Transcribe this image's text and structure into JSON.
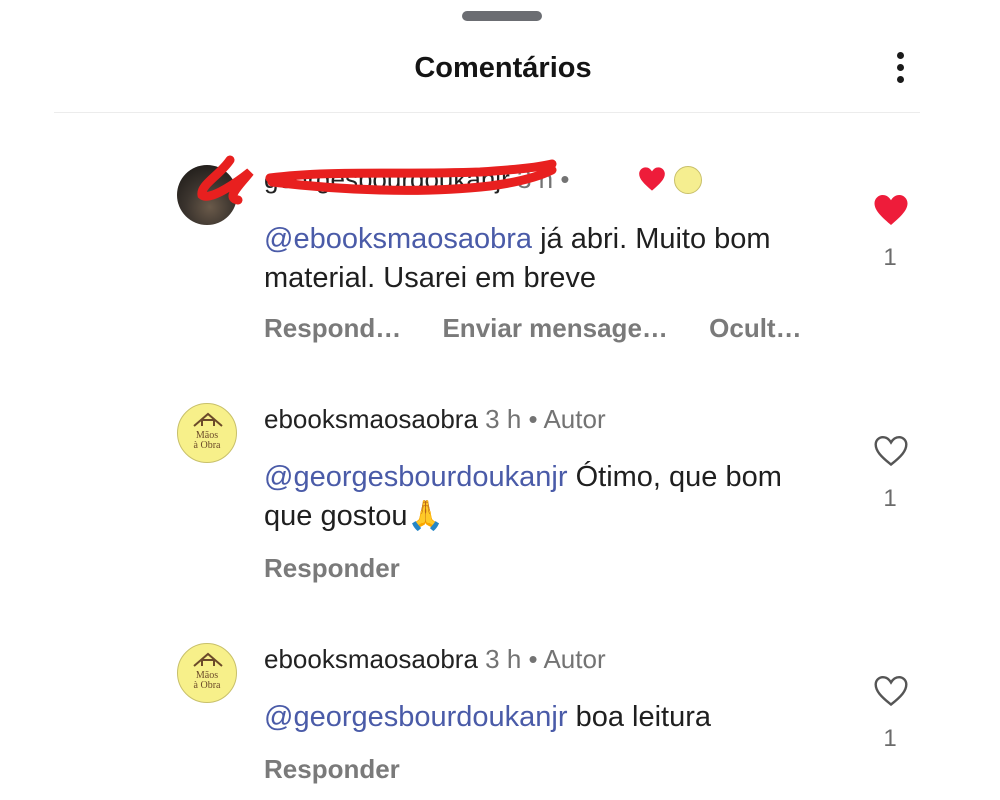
{
  "header": {
    "title": "Comentários",
    "more_icon": "more-vertical-icon"
  },
  "comments": [
    {
      "username": "georgesbourdoukanjr",
      "time": "3 h",
      "dot": "•",
      "author_badge": "",
      "mention": "@ebooksmaosaobra",
      "text": " já abri. Muito bom material. Usarei em breve",
      "actions": [
        "Respond…",
        "Enviar mensage…",
        "Ocult…"
      ],
      "liked": true,
      "likes": "1",
      "liked_by_author": true
    },
    {
      "username": "ebooksmaosaobra",
      "time": "3 h",
      "dot": "•",
      "author_badge": "Autor",
      "mention": "@georgesbourdoukanjr",
      "text": " Ótimo, que bom que gostou🙏",
      "actions": [
        "Responder"
      ],
      "liked": false,
      "likes": "1"
    },
    {
      "username": "ebooksmaosaobra",
      "time": "3 h",
      "dot": "•",
      "author_badge": "Autor",
      "mention": "@georgesbourdoukanjr",
      "text": " boa leitura",
      "actions": [
        "Responder"
      ],
      "liked": false,
      "likes": "1"
    }
  ],
  "brand_avatar_text": [
    "Mãos",
    "à Obra"
  ],
  "colors": {
    "mention": "#4a5ba8",
    "heart_red": "#ee1c3a",
    "redaction": "#e8201f",
    "avatar_yellow": "#f7f08a"
  }
}
